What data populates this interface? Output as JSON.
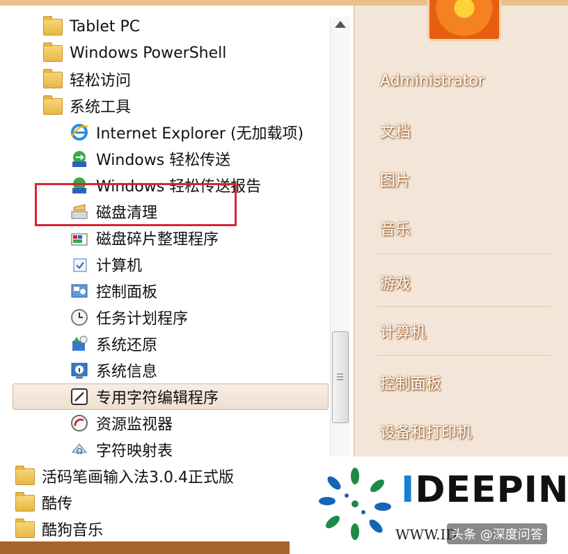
{
  "programs": {
    "items": [
      {
        "label": "Tablet PC",
        "icon": "folder-icon"
      },
      {
        "label": "Windows PowerShell",
        "icon": "folder-icon"
      },
      {
        "label": "轻松访问",
        "icon": "folder-icon"
      },
      {
        "label": "系统工具",
        "icon": "folder-icon"
      },
      {
        "label": "Internet Explorer (无加载项)",
        "icon": "internet-explorer-icon"
      },
      {
        "label": "Windows 轻松传送",
        "icon": "easy-transfer-icon"
      },
      {
        "label": "Windows 轻松传送报告",
        "icon": "easy-transfer-report-icon"
      },
      {
        "label": "磁盘清理",
        "icon": "disk-cleanup-icon"
      },
      {
        "label": "磁盘碎片整理程序",
        "icon": "disk-defragmenter-icon"
      },
      {
        "label": "计算机",
        "icon": "computer-icon"
      },
      {
        "label": "控制面板",
        "icon": "control-panel-icon"
      },
      {
        "label": "任务计划程序",
        "icon": "task-scheduler-icon"
      },
      {
        "label": "系统还原",
        "icon": "system-restore-icon"
      },
      {
        "label": "系统信息",
        "icon": "system-information-icon"
      },
      {
        "label": "专用字符编辑程序",
        "icon": "private-character-editor-icon"
      },
      {
        "label": "资源监视器",
        "icon": "resource-monitor-icon"
      },
      {
        "label": "字符映射表",
        "icon": "character-map-icon"
      },
      {
        "label": "活码笔画输入法3.0.4正式版",
        "icon": "folder-icon"
      },
      {
        "label": "酷传",
        "icon": "folder-icon"
      },
      {
        "label": "酷狗音乐",
        "icon": "folder-icon"
      }
    ]
  },
  "right": {
    "username": "Administrator",
    "links": [
      "文档",
      "图片",
      "音乐",
      "游戏",
      "计算机",
      "控制面板",
      "设备和打印机"
    ]
  },
  "watermark": {
    "brand_prefix": "I",
    "brand_rest": "DEEPIN",
    "url": "WWW.ID",
    "stamp": "头条 @深度问答"
  },
  "colors": {
    "highlight_box": "#d7262d",
    "accent": "#e9c08a"
  }
}
